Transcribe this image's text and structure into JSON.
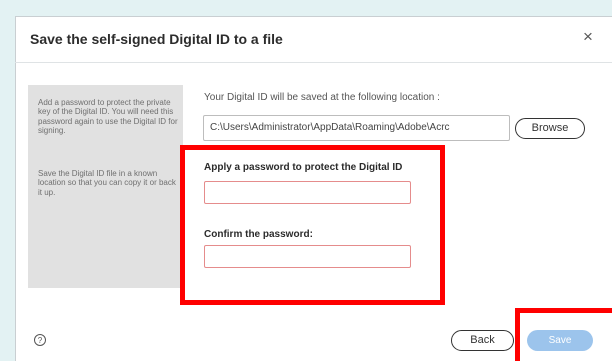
{
  "dialog": {
    "title": "Save the self-signed Digital ID to a file",
    "close_glyph": "×",
    "sidebar": {
      "para1": "Add a password to protect the private key of the Digital ID. You will need this password again to use the Digital ID for signing.",
      "para2": "Save the Digital ID file in a known location so that you can copy it or back it up."
    },
    "location": {
      "label": "Your Digital ID will be saved at the following location :",
      "path": "C:\\Users\\Administrator\\AppData\\Roaming\\Adobe\\Acrc",
      "browse_label": "Browse"
    },
    "password": {
      "label": "Apply a password to protect the Digital ID",
      "value": ""
    },
    "confirm": {
      "label": "Confirm the password:",
      "value": ""
    },
    "footer": {
      "help_glyph": "?",
      "back_label": "Back",
      "save_label": "Save"
    }
  },
  "colors": {
    "highlight": "#ff0000",
    "save_button": "#9cc4ec",
    "input_border": "#e58c8c",
    "background": "#e3f2f3"
  }
}
